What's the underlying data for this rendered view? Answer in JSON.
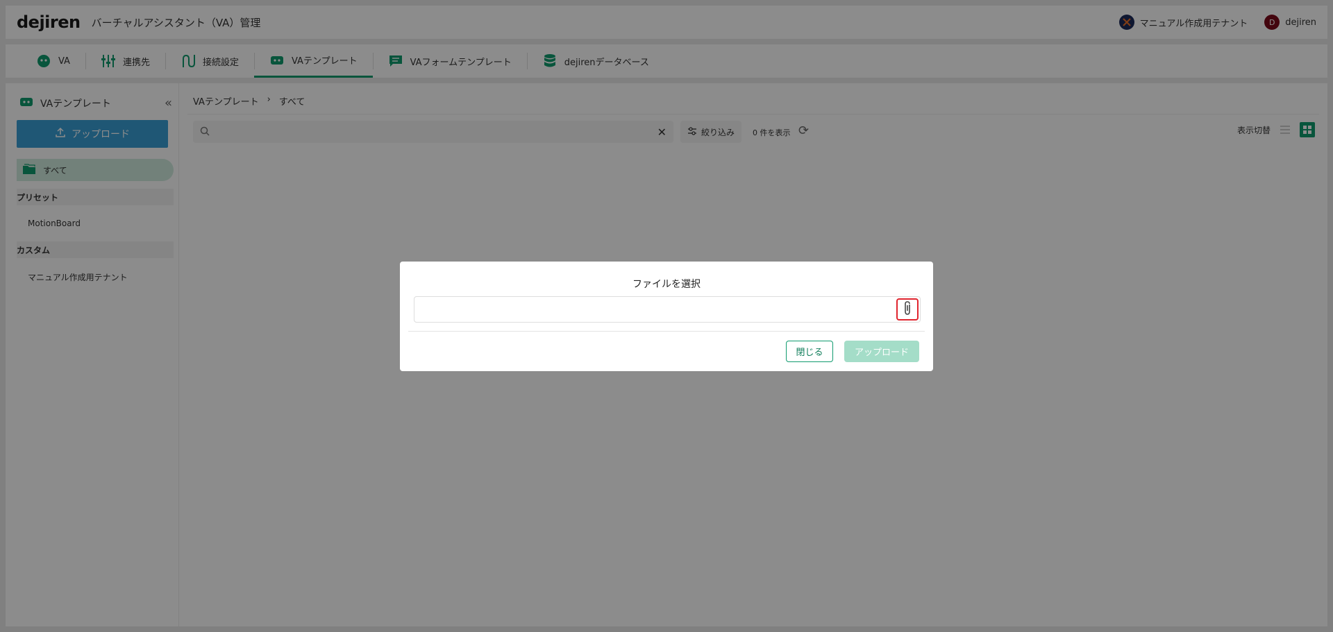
{
  "header": {
    "logo": "dejiren",
    "title": "バーチャルアシスタント（VA）管理",
    "tenant": "マニュアル作成用テナント",
    "user_initial": "D",
    "user": "dejiren"
  },
  "nav": {
    "tabs": [
      {
        "label": "VA",
        "icon": "robot-icon"
      },
      {
        "label": "連携先",
        "icon": "sliders-icon"
      },
      {
        "label": "接続設定",
        "icon": "connection-icon"
      },
      {
        "label": "VAテンプレート",
        "icon": "robot-template-icon",
        "active": true
      },
      {
        "label": "VAフォームテンプレート",
        "icon": "form-icon"
      },
      {
        "label": "dejirenデータベース",
        "icon": "database-icon"
      }
    ]
  },
  "sidebar": {
    "title": "VAテンプレート",
    "upload_label": "アップロード",
    "all_label": "すべて",
    "preset_label": "プリセット",
    "preset_items": [
      "MotionBoard"
    ],
    "custom_label": "カスタム",
    "custom_items": [
      "マニュアル作成用テナント"
    ]
  },
  "main": {
    "breadcrumb": [
      "VAテンプレート",
      "すべて"
    ],
    "breadcrumb_sep": "›",
    "search_placeholder": "",
    "filter_label": "絞り込み",
    "count_text": "0 件を表示",
    "view_switch_label": "表示切替"
  },
  "dialog": {
    "title": "ファイルを選択",
    "file_value": "",
    "close_label": "閉じる",
    "upload_label": "アップロード"
  },
  "colors": {
    "accent": "#0f9b6e",
    "upload_button": "#3a9fd6",
    "highlight_border": "#e0242e"
  }
}
